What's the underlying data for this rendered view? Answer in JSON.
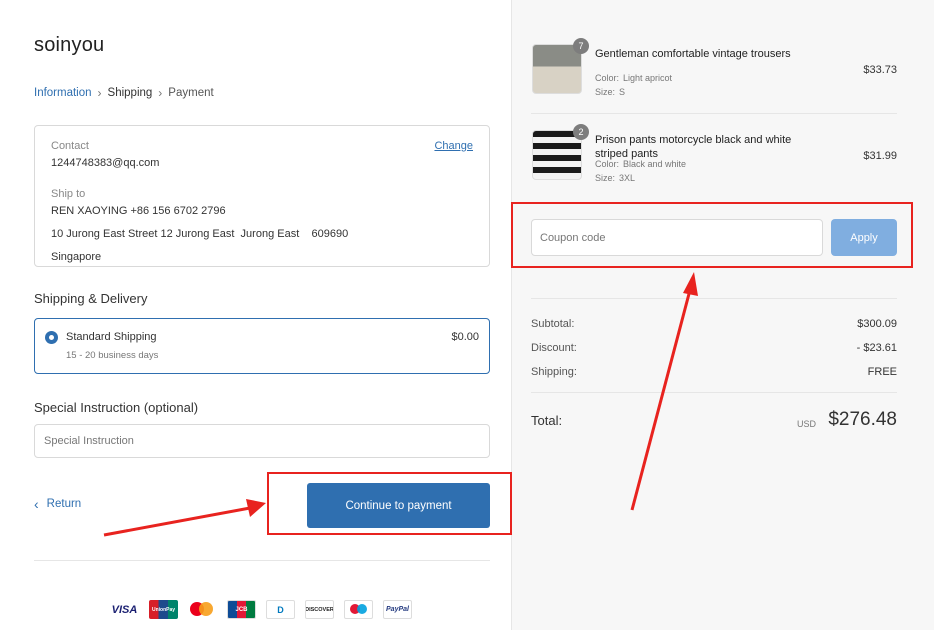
{
  "store": {
    "name": "soinyou"
  },
  "breadcrumb": {
    "step1": "Information",
    "step2": "Shipping",
    "step3": "Payment"
  },
  "info": {
    "contact_label": "Contact",
    "contact_value": "1244748383@qq.com",
    "change_label": "Change",
    "ship_to_label": "Ship to",
    "ship_name": "REN XAOYING +86 156 6702 2796",
    "ship_address": "10 Jurong East Street 12 Jurong East  Jurong East    609690",
    "ship_country": "Singapore"
  },
  "shipping": {
    "title": "Shipping & Delivery",
    "option_name": "Standard Shipping",
    "option_days": "15 - 20 business days",
    "option_price": "$0.00",
    "selected": true
  },
  "instruction": {
    "title": "Special Instruction (optional)",
    "placeholder": "Special Instruction"
  },
  "actions": {
    "return_label": "Return",
    "continue_label": "Continue to payment"
  },
  "payment_methods": [
    "VISA",
    "UnionPay",
    "Mastercard",
    "JCB",
    "Diners Club",
    "DISCOVER",
    "Maestro",
    "PayPal"
  ],
  "payment_text": {
    "visa": "VISA",
    "union": "UnionPay",
    "jcb": "JCB",
    "diners": "D",
    "discover": "DISCOVER",
    "paypal": "PayPal"
  },
  "cart": {
    "items": [
      {
        "qty": "7",
        "title": "Gentleman comfortable vintage trousers",
        "color_label": "Color:",
        "color": "Light apricot",
        "size_label": "Size:",
        "size": "S",
        "price": "$33.73"
      },
      {
        "qty": "2",
        "title": "Prison pants motorcycle black and white striped pants",
        "color_label": "Color:",
        "color": "Black and white",
        "size_label": "Size:",
        "size": "3XL",
        "price": "$31.99"
      }
    ],
    "coupon_placeholder": "Coupon code",
    "apply_label": "Apply"
  },
  "summary": {
    "subtotal_label": "Subtotal:",
    "subtotal": "$300.09",
    "discount_label": "Discount:",
    "discount": "- $23.61",
    "shipping_label": "Shipping:",
    "shipping": "FREE",
    "total_label": "Total:",
    "currency": "USD",
    "total": "$276.48"
  },
  "colors": {
    "primary": "#2f6fb0",
    "apply_button": "#80aee0",
    "annotation_red": "#e8231f",
    "sidebar_bg": "#f7f7f7"
  }
}
